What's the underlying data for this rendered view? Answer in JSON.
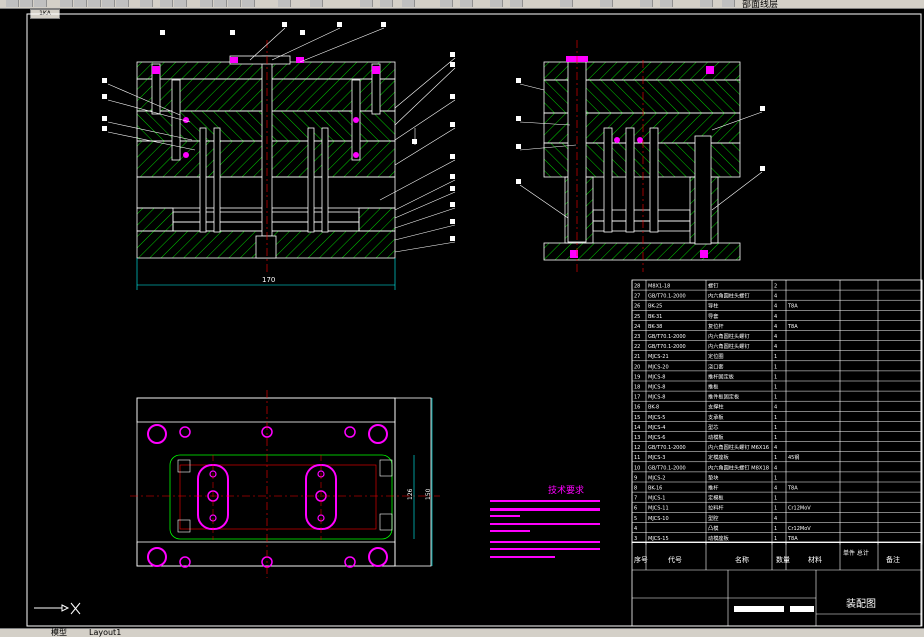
{
  "toolbar": {
    "layer_label": "部面线层"
  },
  "document_tab": "1KA",
  "layout_tabs": [
    "模型",
    "Layout1"
  ],
  "technical_requirements": {
    "title": "技术要求"
  },
  "dimensions": {
    "front_width": "170",
    "bottom_h1": "150",
    "bottom_h2": "126"
  },
  "callouts": {
    "left_view": [
      "1",
      "2",
      "3",
      "4",
      "5",
      "6",
      "7",
      "8",
      "9",
      "10",
      "11",
      "12",
      "13",
      "14",
      "15",
      "16",
      "17",
      "18",
      "19",
      "20",
      "21"
    ],
    "right_view": [
      "22",
      "23",
      "24",
      "25",
      "26",
      "27"
    ]
  },
  "title_block": {
    "drawing_title": "装配图",
    "header_code": "代号",
    "header_name": "名称",
    "header_qty": "数量",
    "header_material": "材料",
    "header_weight": "单件 总计",
    "header_note": "备注",
    "header_seq": "序号"
  },
  "bom": [
    [
      "28",
      "M8X1-18",
      "螺钉",
      "2",
      ""
    ],
    [
      "27",
      "GB/T70.1-2000",
      "内六角圆柱头螺钉",
      "4",
      ""
    ],
    [
      "26",
      "BK-25",
      "导柱",
      "4",
      "T8A"
    ],
    [
      "25",
      "BK-31",
      "导套",
      "4",
      ""
    ],
    [
      "24",
      "BK-38",
      "复位杆",
      "4",
      "T8A"
    ],
    [
      "23",
      "GB/T70.1-2000",
      "内六角圆柱头螺钉",
      "4",
      ""
    ],
    [
      "22",
      "GB/T70.1-2000",
      "内六角圆柱头螺钉",
      "4",
      ""
    ],
    [
      "21",
      "MJCS-21",
      "定位圈",
      "1",
      ""
    ],
    [
      "20",
      "MJCS-20",
      "浇口套",
      "1",
      ""
    ],
    [
      "19",
      "MJCS-8",
      "推杆固定板",
      "1",
      ""
    ],
    [
      "18",
      "MJCS-8",
      "推板",
      "1",
      ""
    ],
    [
      "17",
      "MJCS-8",
      "推件板固定板",
      "1",
      ""
    ],
    [
      "16",
      "BK-8",
      "支撑柱",
      "4",
      ""
    ],
    [
      "15",
      "MJCS-5",
      "支承板",
      "1",
      ""
    ],
    [
      "14",
      "MJCS-4",
      "型芯",
      "1",
      ""
    ],
    [
      "13",
      "MJCS-6",
      "动模板",
      "1",
      ""
    ],
    [
      "12",
      "GB/T70.1-2000",
      "内六角圆柱头螺钉 M6X16",
      "4",
      ""
    ],
    [
      "11",
      "MJCS-3",
      "定模座板",
      "1",
      "45钢"
    ],
    [
      "10",
      "GB/T70.1-2000",
      "内六角圆柱头螺钉 M8X18",
      "4",
      ""
    ],
    [
      "9",
      "MJCS-2",
      "垫块",
      "1",
      ""
    ],
    [
      "8",
      "BK-16",
      "推杆",
      "4",
      "T8A"
    ],
    [
      "7",
      "MJCS-1",
      "定模板",
      "1",
      ""
    ],
    [
      "6",
      "MJCS-11",
      "拉料杆",
      "1",
      "Cr12MoV"
    ],
    [
      "5",
      "MJCS-10",
      "型腔",
      "4",
      ""
    ],
    [
      "4",
      "",
      "凸模",
      "1",
      "Cr12MoV"
    ],
    [
      "3",
      "MJCS-15",
      "动模座板",
      "1",
      "T8A"
    ]
  ],
  "colors": {
    "plate": "#00ff00",
    "line": "#ffffff",
    "hole": "#ff00ff",
    "dim": "#00ffff",
    "hatch": "#00cc00"
  }
}
